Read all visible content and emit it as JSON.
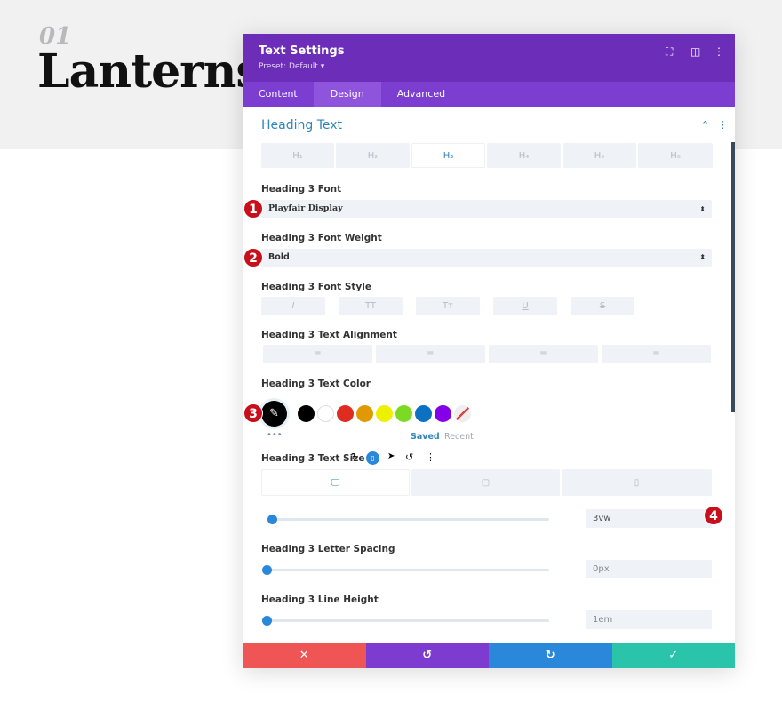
{
  "page": {
    "number": "01",
    "title": "Lanterns"
  },
  "modal": {
    "title": "Text Settings",
    "preset": "Preset: Default ▾",
    "tabs": [
      "Content",
      "Design",
      "Advanced"
    ],
    "active_tab": "Design",
    "section": "Heading Text",
    "heading_levels": [
      "H₁",
      "H₂",
      "H₃",
      "H₄",
      "H₅",
      "H₆"
    ],
    "active_level": "H₃",
    "font_label": "Heading 3 Font",
    "font_value": "Playfair Display",
    "weight_label": "Heading 3 Font Weight",
    "weight_value": "Bold",
    "style_label": "Heading 3 Font Style",
    "style_buttons": [
      "I",
      "TT",
      "Tт",
      "U",
      "S"
    ],
    "align_label": "Heading 3 Text Alignment",
    "color_label": "Heading 3 Text Color",
    "swatches": [
      "#000000",
      "#ffffff",
      "#e02b20",
      "#e09900",
      "#edf000",
      "#7cda24",
      "#0c71c3",
      "#8300e9"
    ],
    "saved": "Saved",
    "recent": "Recent",
    "size_label": "Heading 3 Text Size",
    "size_value": "3vw",
    "size_fraction": 0.03,
    "spacing_label": "Heading 3 Letter Spacing",
    "spacing_value": "0px",
    "lineheight_label": "Heading 3 Line Height",
    "lineheight_value": "1em",
    "badges": [
      "1",
      "2",
      "3",
      "4"
    ],
    "footer_colors": {
      "cancel": "#ef5555",
      "undo": "#7e3bd0",
      "redo": "#2b87da",
      "save": "#29c4a9"
    }
  }
}
